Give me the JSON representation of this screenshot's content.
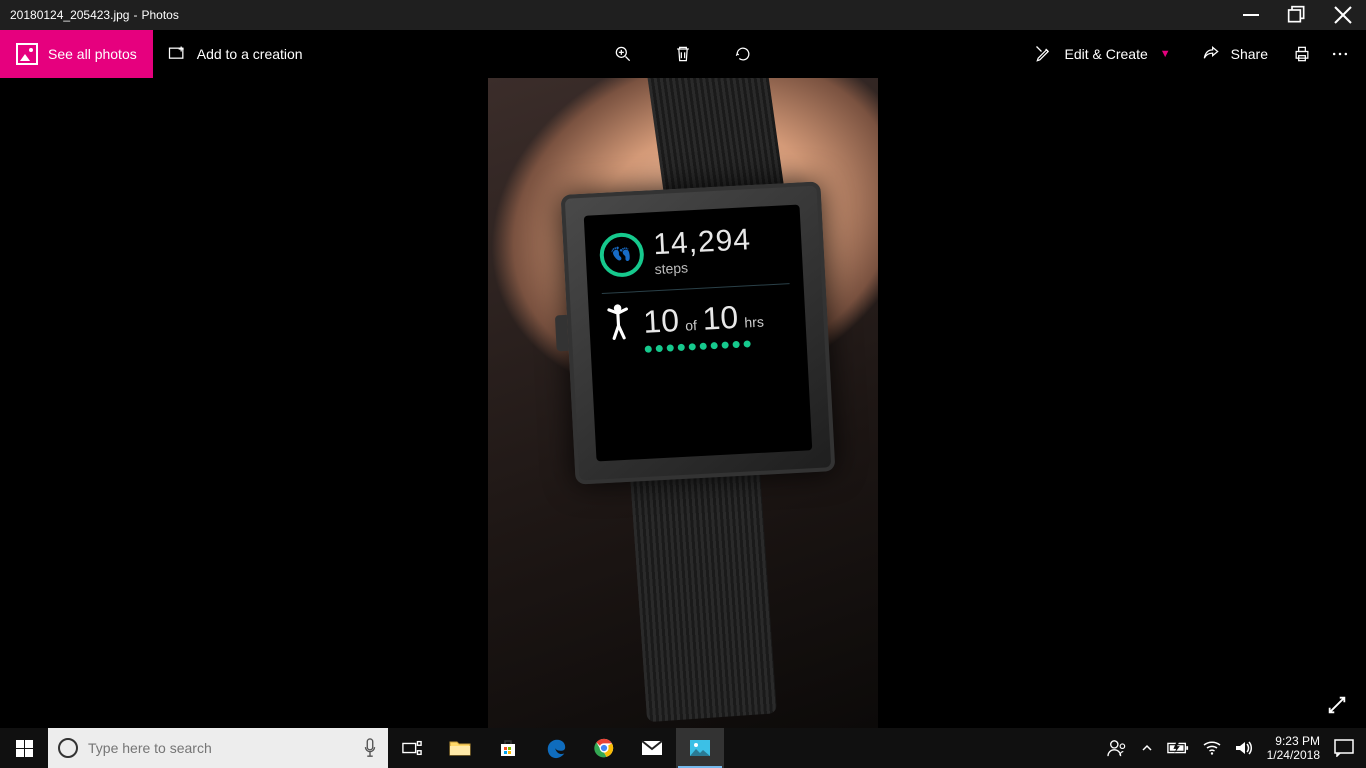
{
  "titlebar": {
    "filename": "20180124_205423.jpg",
    "appname": "Photos"
  },
  "toolbar": {
    "see_all": "See all photos",
    "add_creation": "Add to a creation",
    "edit_create": "Edit & Create",
    "share": "Share"
  },
  "photo": {
    "steps_value": "14,294",
    "steps_label": "steps",
    "hours_done": "10",
    "hours_of": "of",
    "hours_total": "10",
    "hours_unit": "hrs"
  },
  "search": {
    "placeholder": "Type here to search"
  },
  "tray": {
    "time": "9:23 PM",
    "date": "1/24/2018"
  }
}
